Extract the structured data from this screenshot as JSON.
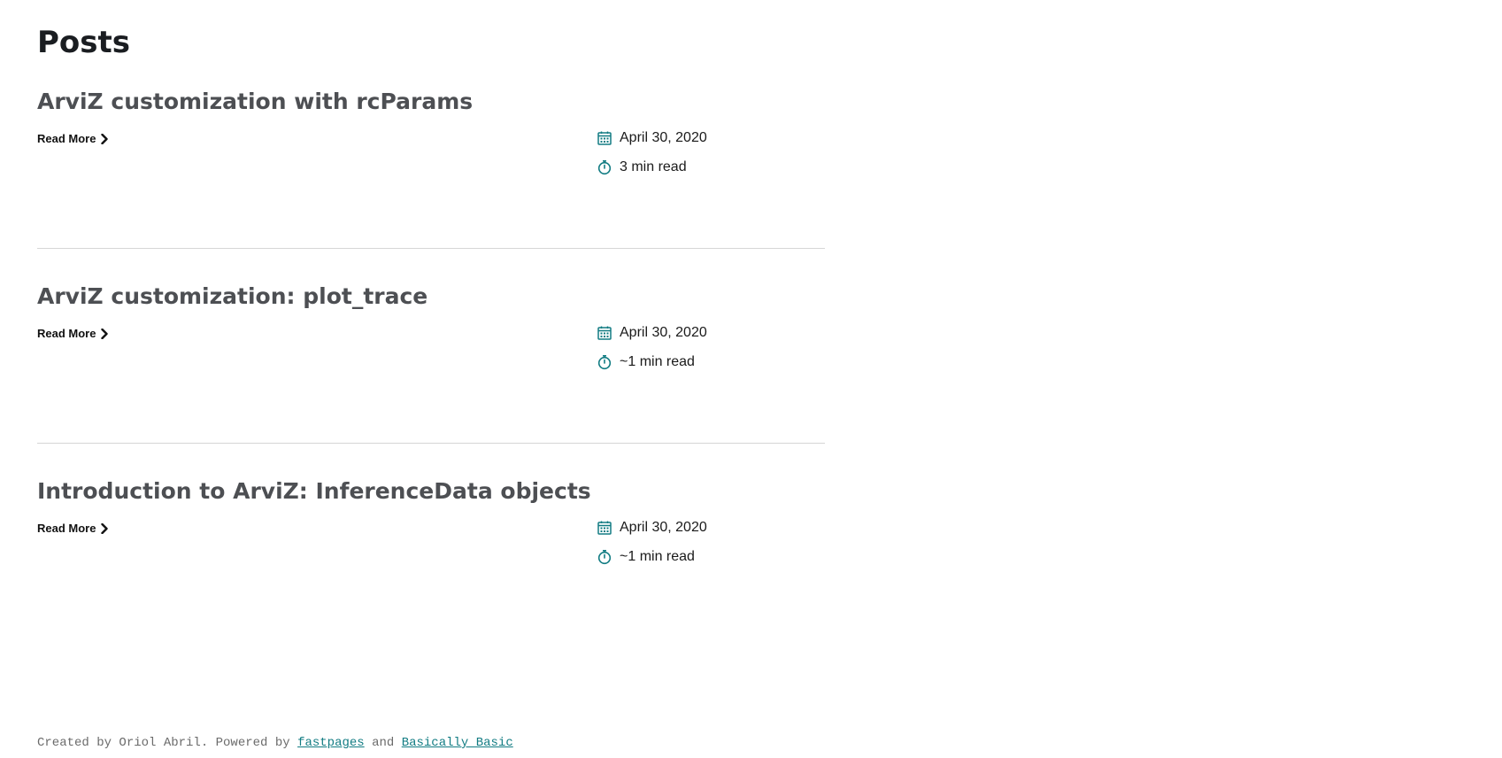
{
  "page": {
    "title": "Posts"
  },
  "posts": [
    {
      "title": "ArviZ customization with rcParams",
      "read_more": "Read More",
      "date": "April 30, 2020",
      "read_time": "3 min read"
    },
    {
      "title": "ArviZ customization: plot_trace",
      "read_more": "Read More",
      "date": "April 30, 2020",
      "read_time": "~1 min read"
    },
    {
      "title": "Introduction to ArviZ: InferenceData objects",
      "read_more": "Read More",
      "date": "April 30, 2020",
      "read_time": "~1 min read"
    }
  ],
  "footer": {
    "prefix": "Created by Oriol Abril. Powered by ",
    "link1": "fastpages",
    "middle": " and ",
    "link2": "Basically Basic"
  },
  "icons": {
    "date": "calendar-icon",
    "read_time": "stopwatch-icon",
    "read_more": "chevron-right-icon"
  },
  "colors": {
    "accent": "#127c83",
    "title": "#1a1d21",
    "post_title": "#4d4f53",
    "divider": "#d6d6d6"
  }
}
